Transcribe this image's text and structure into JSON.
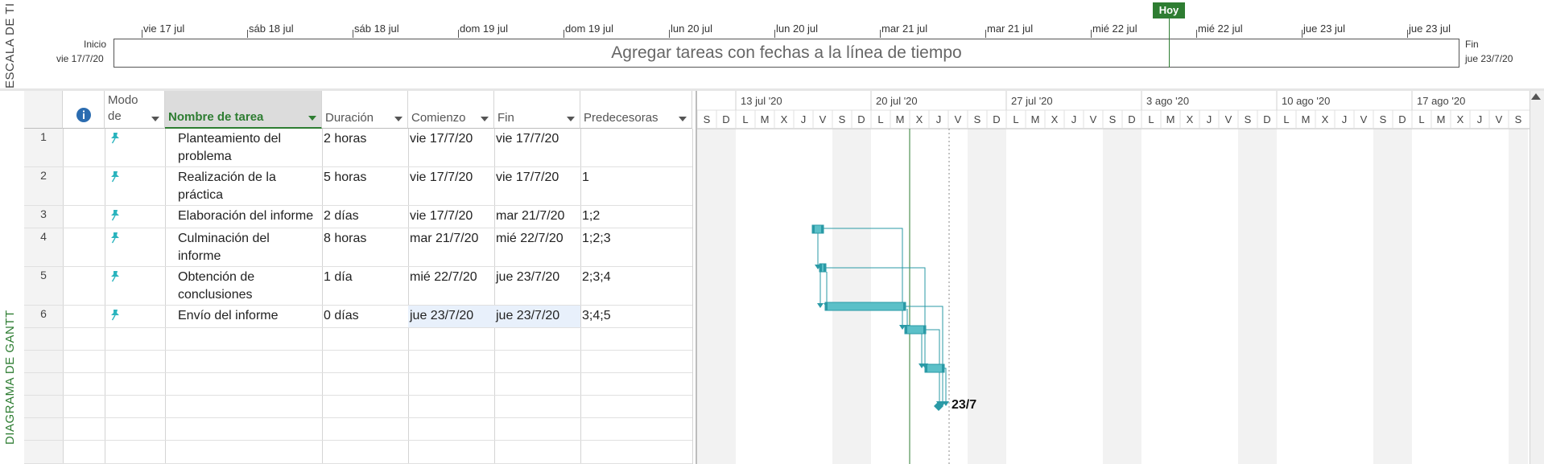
{
  "timeline": {
    "side_title": "ESCALA DE TI",
    "start_label": "Inicio",
    "start_date": "vie 17/7/20",
    "end_label": "Fin",
    "end_date": "jue 23/7/20",
    "placeholder": "Agregar tareas con fechas a la línea de tiempo",
    "today_label": "Hoy",
    "ticks": [
      "vie 17 jul",
      "sáb 18 jul",
      "sáb 18 jul",
      "dom 19 jul",
      "dom 19 jul",
      "lun 20 jul",
      "lun 20 jul",
      "mar 21 jul",
      "mar 21 jul",
      "mié 22 jul",
      "mié 22 jul",
      "jue 23 jul",
      "jue 23 jul"
    ]
  },
  "gantt": {
    "side_title": "DIAGRAMA DE GANTT",
    "columns": {
      "mode": "Modo de",
      "name": "Nombre de tarea",
      "duration": "Duración",
      "start": "Comienzo",
      "finish": "Fin",
      "predecessors": "Predecesoras"
    },
    "tasks": [
      {
        "id": "1",
        "name": "Planteamiento del problema",
        "duration": "2 horas",
        "start": "vie 17/7/20",
        "finish": "vie 17/7/20",
        "pred": ""
      },
      {
        "id": "2",
        "name": "Realización de la práctica",
        "duration": "5 horas",
        "start": "vie 17/7/20",
        "finish": "vie 17/7/20",
        "pred": "1"
      },
      {
        "id": "3",
        "name": "Elaboración del informe",
        "duration": "2 días",
        "start": "vie 17/7/20",
        "finish": "mar 21/7/20",
        "pred": "1;2"
      },
      {
        "id": "4",
        "name": "Culminación del informe",
        "duration": "8 horas",
        "start": "mar 21/7/20",
        "finish": "mié 22/7/20",
        "pred": "1;2;3"
      },
      {
        "id": "5",
        "name": "Obtención de conclusiones",
        "duration": "1 día",
        "start": "mié 22/7/20",
        "finish": "jue 23/7/20",
        "pred": "2;3;4"
      },
      {
        "id": "6",
        "name": "Envío del informe",
        "duration": "0 días",
        "start": "jue 23/7/20",
        "finish": "jue 23/7/20",
        "pred": "3;4;5"
      }
    ],
    "name_lines": [
      [
        "Planteamiento del",
        "problema"
      ],
      [
        "Realización de la",
        "práctica"
      ],
      [
        "Elaboración del informe"
      ],
      [
        "Culminación del",
        "informe"
      ],
      [
        "Obtención de",
        "conclusiones"
      ],
      [
        "Envío del informe"
      ]
    ]
  },
  "chart": {
    "weeks": [
      "13 jul '20",
      "20 jul '20",
      "27 jul '20",
      "3 ago '20",
      "10 ago '20",
      "17 ago '20"
    ],
    "day_letters": [
      "S",
      "D",
      "L",
      "M",
      "X",
      "J",
      "V",
      "S",
      "D",
      "L",
      "M",
      "X",
      "J",
      "V",
      "S",
      "D",
      "L",
      "M",
      "X",
      "J",
      "V",
      "S",
      "D",
      "L",
      "M",
      "X",
      "J",
      "V",
      "S",
      "D",
      "L",
      "M",
      "X",
      "J",
      "V",
      "S",
      "D",
      "L",
      "M",
      "X",
      "J",
      "V",
      "S"
    ],
    "milestone_label": "23/7",
    "bar_color": "#5bc0c8",
    "bar_dark": "#2a9aa6",
    "today_color": "#2e7d32"
  }
}
